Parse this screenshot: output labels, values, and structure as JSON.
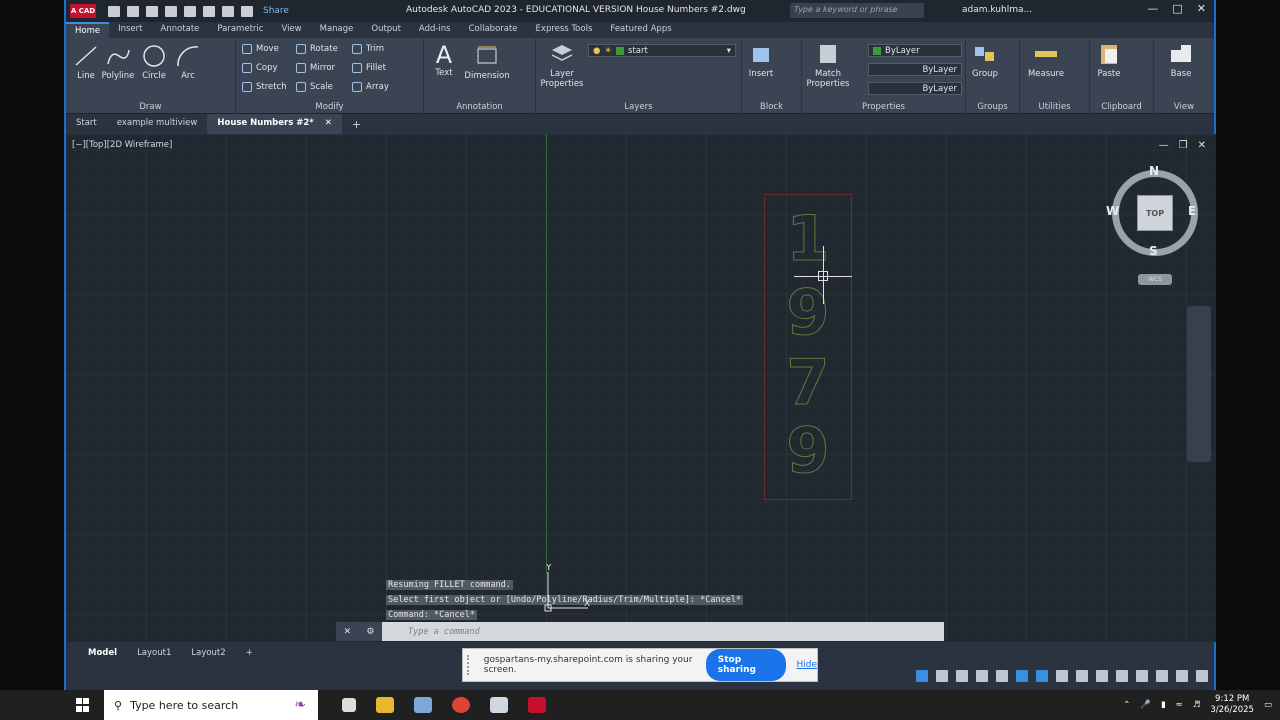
{
  "titlebar": {
    "logo": "A CAD",
    "share": "Share",
    "title": "Autodesk AutoCAD 2023 - EDUCATIONAL VERSION    House Numbers #2.dwg",
    "search_placeholder": "Type a keyword or phrase",
    "user": "adam.kuhlma..."
  },
  "ribbon_tabs": [
    "Home",
    "Insert",
    "Annotate",
    "Parametric",
    "View",
    "Manage",
    "Output",
    "Add-ins",
    "Collaborate",
    "Express Tools",
    "Featured Apps"
  ],
  "ribbon": {
    "draw": {
      "label": "Draw",
      "line": "Line",
      "polyline": "Polyline",
      "circle": "Circle",
      "arc": "Arc"
    },
    "modify": {
      "label": "Modify",
      "move": "Move",
      "rotate": "Rotate",
      "trim": "Trim",
      "copy": "Copy",
      "mirror": "Mirror",
      "fillet": "Fillet",
      "stretch": "Stretch",
      "scale": "Scale",
      "array": "Array"
    },
    "annotation": {
      "label": "Annotation",
      "text": "Text",
      "dimension": "Dimension"
    },
    "layers": {
      "label": "Layers",
      "layer_properties": "Layer\nProperties",
      "current_layer": "start"
    },
    "block": {
      "label": "Block",
      "insert": "Insert"
    },
    "properties": {
      "label": "Properties",
      "match": "Match\nProperties",
      "color": "ByLayer",
      "linetype": "ByLayer",
      "lineweight": "ByLayer"
    },
    "groups": {
      "label": "Groups",
      "group": "Group"
    },
    "utilities": {
      "label": "Utilities",
      "measure": "Measure"
    },
    "clipboard": {
      "label": "Clipboard",
      "paste": "Paste"
    },
    "view": {
      "label": "View",
      "base": "Base"
    }
  },
  "doc_tabs": [
    "Start",
    "example multiview",
    "House Numbers #2*"
  ],
  "viewport_label": "[−][Top][2D Wireframe]",
  "drawing": {
    "digits": [
      "1",
      "9",
      "7",
      "9"
    ]
  },
  "viewcube": {
    "n": "N",
    "s": "S",
    "e": "E",
    "w": "W",
    "face": "TOP",
    "wcs": "WCS"
  },
  "command_history": [
    "Resuming FILLET command.",
    "Select first object or [Undo/Polyline/Radius/Trim/Multiple]: *Cancel*",
    "Command: *Cancel*"
  ],
  "command_placeholder": "Type a command",
  "layout_tabs": [
    "Model",
    "Layout1",
    "Layout2"
  ],
  "sharebar": {
    "message": "gospartans-my.sharepoint.com is sharing your screen.",
    "stop": "Stop sharing",
    "hide": "Hide"
  },
  "taskbar": {
    "search": "Type here to search",
    "time": "9:12 PM",
    "date": "3/26/2025"
  },
  "colors": {
    "accent": "#3b8fe0",
    "background": "#212830",
    "brand": "#c8102e"
  }
}
